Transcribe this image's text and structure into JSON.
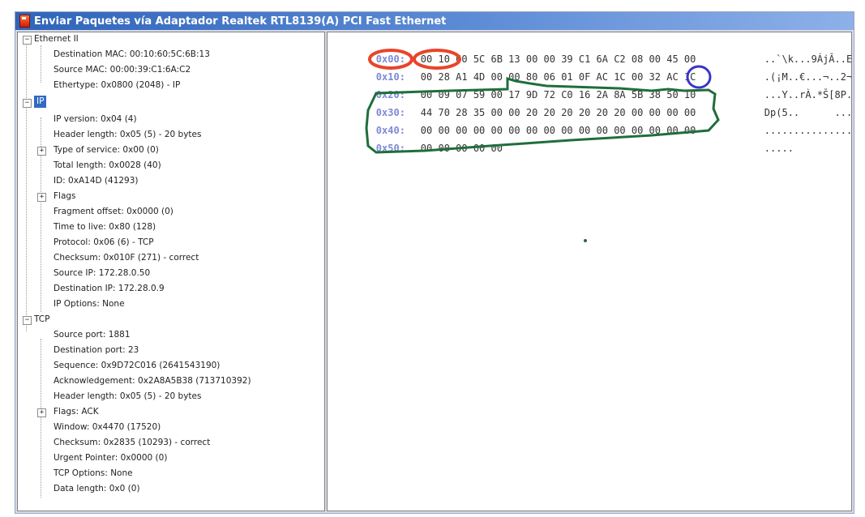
{
  "window": {
    "title": "Enviar Paquetes vía  Adaptador Realtek RTL8139(A) PCI Fast Ethernet"
  },
  "tree": {
    "ethernet": {
      "label": "Ethernet II",
      "dst_mac": "Destination MAC: 00:10:60:5C:6B:13",
      "src_mac": "Source MAC: 00:00:39:C1:6A:C2",
      "ethertype": "Ethertype: 0x0800 (2048) - IP"
    },
    "ip": {
      "label": "IP",
      "version": "IP version: 0x04 (4)",
      "header_length": "Header length: 0x05 (5) - 20 bytes",
      "tos": "Type of service: 0x00 (0)",
      "total_length": "Total length: 0x0028 (40)",
      "id": "ID: 0xA14D (41293)",
      "flags": "Flags",
      "fragment_offset": "Fragment offset: 0x0000 (0)",
      "ttl": "Time to live: 0x80 (128)",
      "protocol": "Protocol: 0x06 (6) - TCP",
      "checksum": "Checksum: 0x010F (271) - correct",
      "src_ip": "Source IP: 172.28.0.50",
      "dst_ip": "Destination IP: 172.28.0.9",
      "options": "IP Options: None"
    },
    "tcp": {
      "label": "TCP",
      "src_port": "Source port: 1881",
      "dst_port": "Destination port: 23",
      "sequence": "Sequence: 0x9D72C016 (2641543190)",
      "ack": "Acknowledgement: 0x2A8A5B38 (713710392)",
      "header_length": "Header length: 0x05 (5) - 20 bytes",
      "flags": "Flags: ACK",
      "window": "Window: 0x4470 (17520)",
      "checksum": "Checksum: 0x2835 (10293) - correct",
      "urgent": "Urgent Pointer: 0x0000 (0)",
      "options": "TCP Options: None",
      "data_length": "Data length: 0x0 (0)"
    }
  },
  "hex": {
    "rows": [
      {
        "offset": "0x00:",
        "bytes": "00 10 60 5C 6B 13 00 00 39 C1 6A C2 08 00 45 00",
        "ascii": "..`\\k...9ÁjÂ..E."
      },
      {
        "offset": "0x10:",
        "bytes": "00 28 A1 4D 00 00 80 06 01 0F AC 1C 00 32 AC 1C",
        "ascii": ".(¡M..€...¬..2¬."
      },
      {
        "offset": "0x20:",
        "bytes": "00 09 07 59 00 17 9D 72 C0 16 2A 8A 5B 38 50 10",
        "ascii": "...Y..rÀ.*Š[8P."
      },
      {
        "offset": "0x30:",
        "bytes": "44 70 28 35 00 00 20 20 20 20 20 20 00 00 00 00",
        "ascii": "Dp(5..      ...."
      },
      {
        "offset": "0x40:",
        "bytes": "00 00 00 00 00 00 00 00 00 00 00 00 00 00 00 00",
        "ascii": "................"
      },
      {
        "offset": "0x50:",
        "bytes": "00 00 00 00 00",
        "ascii": "....."
      }
    ]
  },
  "annotations": {
    "red": "#e8452a",
    "blue": "#3a35c8",
    "green": "#1f6e3c"
  }
}
